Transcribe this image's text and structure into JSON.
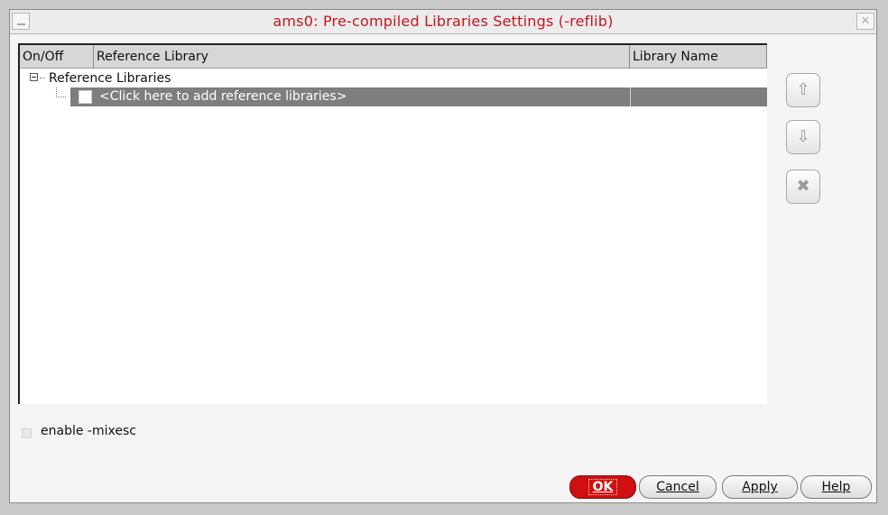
{
  "window": {
    "title": "ams0: Pre-compiled Libraries Settings (-reflib)"
  },
  "table": {
    "columns": [
      "On/Off",
      "Reference Library",
      "Library Name"
    ],
    "tree_root_label": "Reference Libraries",
    "rows": [
      {
        "enabled": false,
        "library": "<Click here to add reference libraries>",
        "name": ""
      }
    ]
  },
  "side_buttons": {
    "up": "move-up",
    "down": "move-down",
    "delete": "remove"
  },
  "options": {
    "enable_mixesc_label": "enable -mixesc",
    "enable_mixesc_checked": false
  },
  "buttons": {
    "ok": "OK",
    "cancel": "Cancel",
    "apply": "Apply",
    "help": "Help"
  },
  "colors": {
    "title": "#c8141e",
    "ok_button": "#d01010",
    "selection": "#7e7e7e"
  }
}
